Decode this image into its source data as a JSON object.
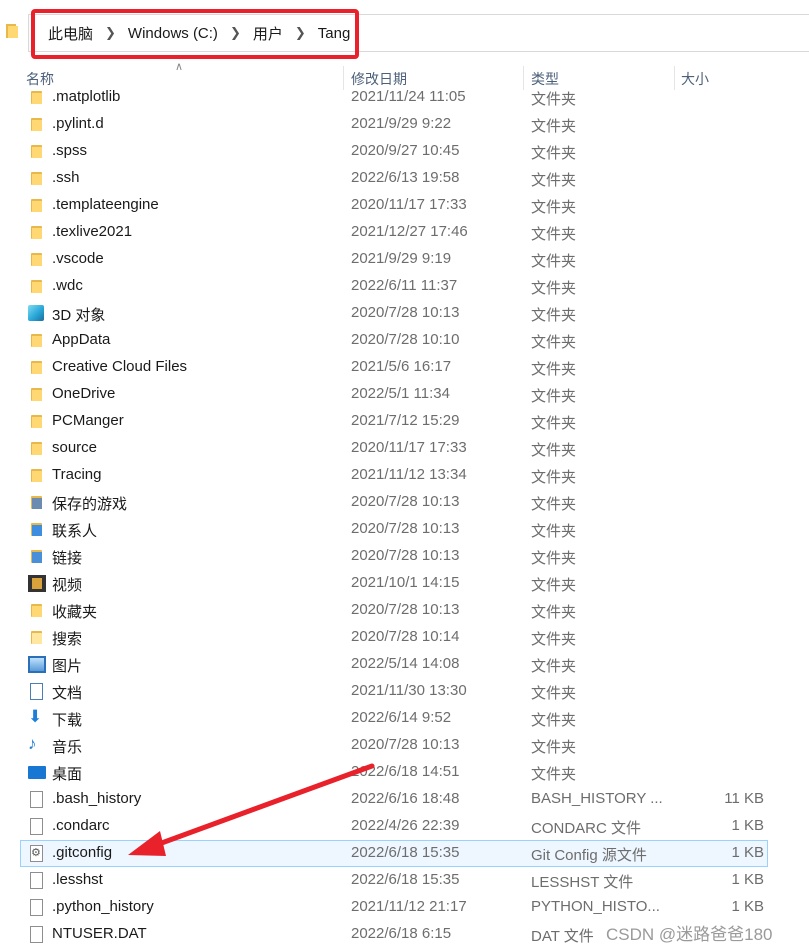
{
  "address": {
    "crumbs": [
      "此电脑",
      "Windows (C:)",
      "用户",
      "Tang"
    ]
  },
  "columns": {
    "name": "名称",
    "date": "修改日期",
    "type": "类型",
    "size": "大小"
  },
  "rows": [
    {
      "name": ".matplotlib",
      "date": "2021/11/24 11:05",
      "type": "文件夹",
      "size": "",
      "icon": "folder-icon"
    },
    {
      "name": ".pylint.d",
      "date": "2021/9/29 9:22",
      "type": "文件夹",
      "size": "",
      "icon": "folder-icon"
    },
    {
      "name": ".spss",
      "date": "2020/9/27 10:45",
      "type": "文件夹",
      "size": "",
      "icon": "folder-icon"
    },
    {
      "name": ".ssh",
      "date": "2022/6/13 19:58",
      "type": "文件夹",
      "size": "",
      "icon": "folder-icon"
    },
    {
      "name": ".templateengine",
      "date": "2020/11/17 17:33",
      "type": "文件夹",
      "size": "",
      "icon": "folder-icon"
    },
    {
      "name": ".texlive2021",
      "date": "2021/12/27 17:46",
      "type": "文件夹",
      "size": "",
      "icon": "folder-icon"
    },
    {
      "name": ".vscode",
      "date": "2021/9/29 9:19",
      "type": "文件夹",
      "size": "",
      "icon": "folder-icon"
    },
    {
      "name": ".wdc",
      "date": "2022/6/11 11:37",
      "type": "文件夹",
      "size": "",
      "icon": "folder-icon"
    },
    {
      "name": "3D 对象",
      "date": "2020/7/28 10:13",
      "type": "文件夹",
      "size": "",
      "icon": "3d-objects-icon"
    },
    {
      "name": "AppData",
      "date": "2020/7/28 10:10",
      "type": "文件夹",
      "size": "",
      "icon": "folder-icon"
    },
    {
      "name": "Creative Cloud Files",
      "date": "2021/5/6 16:17",
      "type": "文件夹",
      "size": "",
      "icon": "folder-icon"
    },
    {
      "name": "OneDrive",
      "date": "2022/5/1 11:34",
      "type": "文件夹",
      "size": "",
      "icon": "folder-icon"
    },
    {
      "name": "PCManger",
      "date": "2021/7/12 15:29",
      "type": "文件夹",
      "size": "",
      "icon": "folder-icon"
    },
    {
      "name": "source",
      "date": "2020/11/17 17:33",
      "type": "文件夹",
      "size": "",
      "icon": "folder-icon"
    },
    {
      "name": "Tracing",
      "date": "2021/11/12 13:34",
      "type": "文件夹",
      "size": "",
      "icon": "folder-icon"
    },
    {
      "name": "保存的游戏",
      "date": "2020/7/28 10:13",
      "type": "文件夹",
      "size": "",
      "icon": "saved-games-icon"
    },
    {
      "name": "联系人",
      "date": "2020/7/28 10:13",
      "type": "文件夹",
      "size": "",
      "icon": "contacts-icon"
    },
    {
      "name": "链接",
      "date": "2020/7/28 10:13",
      "type": "文件夹",
      "size": "",
      "icon": "links-icon"
    },
    {
      "name": "视频",
      "date": "2021/10/1 14:15",
      "type": "文件夹",
      "size": "",
      "icon": "videos-icon"
    },
    {
      "name": "收藏夹",
      "date": "2020/7/28 10:13",
      "type": "文件夹",
      "size": "",
      "icon": "favorites-icon"
    },
    {
      "name": "搜索",
      "date": "2020/7/28 10:14",
      "type": "文件夹",
      "size": "",
      "icon": "searches-icon"
    },
    {
      "name": "图片",
      "date": "2022/5/14 14:08",
      "type": "文件夹",
      "size": "",
      "icon": "pictures-icon"
    },
    {
      "name": "文档",
      "date": "2021/11/30 13:30",
      "type": "文件夹",
      "size": "",
      "icon": "documents-icon"
    },
    {
      "name": "下载",
      "date": "2022/6/14 9:52",
      "type": "文件夹",
      "size": "",
      "icon": "downloads-icon"
    },
    {
      "name": "音乐",
      "date": "2020/7/28 10:13",
      "type": "文件夹",
      "size": "",
      "icon": "music-icon"
    },
    {
      "name": "桌面",
      "date": "2022/6/18 14:51",
      "type": "文件夹",
      "size": "",
      "icon": "desktop-icon"
    },
    {
      "name": ".bash_history",
      "date": "2022/6/16 18:48",
      "type": "BASH_HISTORY ...",
      "size": "11 KB",
      "icon": "file-icon"
    },
    {
      "name": ".condarc",
      "date": "2022/4/26 22:39",
      "type": "CONDARC 文件",
      "size": "1 KB",
      "icon": "file-icon"
    },
    {
      "name": ".gitconfig",
      "date": "2022/6/18 15:35",
      "type": "Git Config 源文件",
      "size": "1 KB",
      "icon": "config-file-icon",
      "selected": true
    },
    {
      "name": ".lesshst",
      "date": "2022/6/18 15:35",
      "type": "LESSHST 文件",
      "size": "1 KB",
      "icon": "file-icon"
    },
    {
      "name": ".python_history",
      "date": "2021/11/12 21:17",
      "type": "PYTHON_HISTO...",
      "size": "1 KB",
      "icon": "file-icon"
    },
    {
      "name": "NTUSER.DAT",
      "date": "2022/6/18 6:15",
      "type": "DAT 文件",
      "size": "",
      "icon": "file-icon"
    }
  ],
  "watermark": "CSDN @迷路爸爸180",
  "colors": {
    "highlight": "#e8212b",
    "folder": "#ffd873",
    "selection_border": "#99d1ff"
  }
}
